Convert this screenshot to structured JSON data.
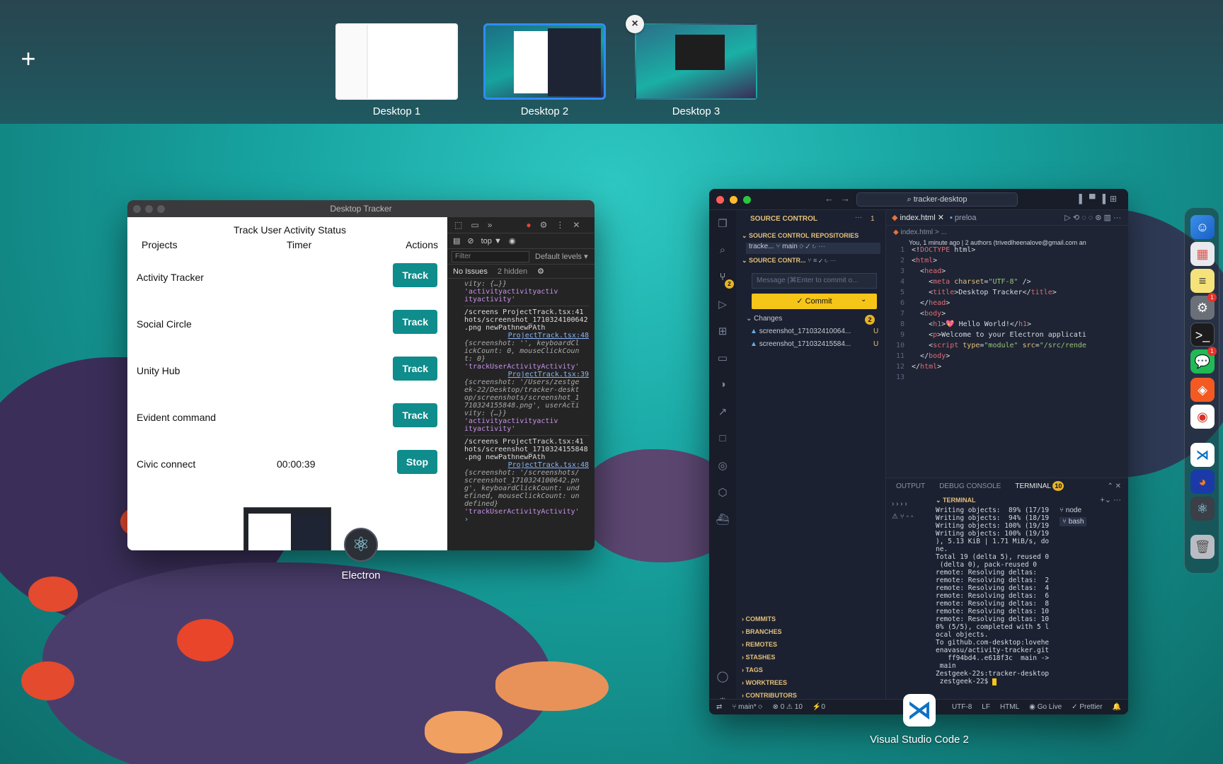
{
  "spaces": {
    "add_label": "+",
    "desktops": [
      {
        "label": "Desktop 1"
      },
      {
        "label": "Desktop 2"
      },
      {
        "label": "Desktop 3"
      }
    ],
    "close_label": "×"
  },
  "electron": {
    "window_title": "Desktop Tracker",
    "app_title": "Track User Activity Status",
    "columns": {
      "projects": "Projects",
      "timer": "Timer",
      "actions": "Actions"
    },
    "rows": [
      {
        "name": "Activity Tracker",
        "timer": "",
        "action": "Track"
      },
      {
        "name": "Social Circle",
        "timer": "",
        "action": "Track"
      },
      {
        "name": "Unity Hub",
        "timer": "",
        "action": "Track"
      },
      {
        "name": "Evident command",
        "timer": "",
        "action": "Track"
      },
      {
        "name": "Civic connect",
        "timer": "00:00:39",
        "action": "Stop"
      }
    ],
    "app_label": "Electron",
    "devtools": {
      "context": "top ▼",
      "filter_placeholder": "Filter",
      "levels": "Default levels ▾",
      "issues": "No Issues",
      "hidden": "2 hidden",
      "console": [
        {
          "t": "vity: {…}}",
          "c": "ital"
        },
        {
          "t": "'activityactivityactiv",
          "c": "purple"
        },
        {
          "t": "ityactivity'",
          "c": "purple"
        },
        {
          "t": "/screens ProjectTrack.tsx:41",
          "c": "sep"
        },
        {
          "t": "hots/screenshot_1710324100642",
          "c": ""
        },
        {
          "t": ".png newPathnewPAth",
          "c": ""
        },
        {
          "t": "ProjectTrack.tsx:48",
          "c": "link"
        },
        {
          "t": "{screenshot: '', keyboardCl",
          "c": "ital"
        },
        {
          "t": "ickCount: 0, mouseClickCoun",
          "c": "ital"
        },
        {
          "t": "t: 0}",
          "c": "ital"
        },
        {
          "t": "'trackUserActivityActivity'",
          "c": "purple"
        },
        {
          "t": "ProjectTrack.tsx:39",
          "c": "link"
        },
        {
          "t": "{screenshot: '/Users/zestge",
          "c": "ital"
        },
        {
          "t": "ek-22/Desktop/tracker-deskt",
          "c": "ital"
        },
        {
          "t": "op/screenshots/screenshot_1",
          "c": "ital"
        },
        {
          "t": "710324155848.png', userActi",
          "c": "ital"
        },
        {
          "t": "vity: {…}}",
          "c": "ital"
        },
        {
          "t": "'activityactivityactiv",
          "c": "purple"
        },
        {
          "t": "ityactivity'",
          "c": "purple"
        },
        {
          "t": "/screens ProjectTrack.tsx:41",
          "c": "sep"
        },
        {
          "t": "hots/screenshot_1710324155848",
          "c": ""
        },
        {
          "t": ".png newPathnewPAth",
          "c": ""
        },
        {
          "t": "ProjectTrack.tsx:48",
          "c": "link"
        },
        {
          "t": "{screenshot: '/screenshots/",
          "c": "ital"
        },
        {
          "t": "screenshot_1710324100642.pn",
          "c": "ital"
        },
        {
          "t": "g', keyboardClickCount: und",
          "c": "ital"
        },
        {
          "t": "efined, mouseClickCount: un",
          "c": "ital"
        },
        {
          "t": "defined}",
          "c": "ital"
        },
        {
          "t": "'trackUserActivityActivity'",
          "c": "purple"
        }
      ]
    }
  },
  "vscode": {
    "search": "tracker-desktop",
    "app_label": "Visual Studio Code 2",
    "sidebar": {
      "header": "SOURCE CONTROL",
      "header_count": "1",
      "repositories": "SOURCE CONTROL REPOSITORIES",
      "repo_name": "tracke...",
      "branch": "main",
      "source_control": "SOURCE CONTR...",
      "message_placeholder": "Message (⌘Enter to commit o...",
      "commit": "✓ Commit",
      "changes": "Changes",
      "changes_count": "2",
      "files": [
        {
          "name": "screenshot_171032410064...",
          "status": "U"
        },
        {
          "name": "screenshot_171032415584...",
          "status": "U"
        }
      ],
      "sections": [
        "COMMITS",
        "BRANCHES",
        "REMOTES",
        "STASHES",
        "TAGS",
        "WORKTREES",
        "CONTRIBUTORS"
      ]
    },
    "editor": {
      "tab1": "index.html",
      "tab2": "preloa",
      "crumb": "index.html > ...",
      "blame": "You, 1 minute ago | 2 authors (trivedlheenalove@gmail.com an",
      "lines": [
        {
          "n": "1",
          "html": "<span class='tx'>&lt;!</span><span class='tg'>DOCTYPE</span><span class='tx'> html&gt;</span>"
        },
        {
          "n": "2",
          "html": "<span class='tx'>&lt;</span><span class='tg'>html</span><span class='tx'>&gt;</span>"
        },
        {
          "n": "3",
          "html": "  <span class='tx'>&lt;</span><span class='tg'>head</span><span class='tx'>&gt;</span>"
        },
        {
          "n": "4",
          "html": "    <span class='tx'>&lt;</span><span class='tg'>meta</span> <span class='at'>charset</span><span class='tx'>=</span><span class='st'>\"UTF-8\"</span><span class='tx'> /&gt;</span>"
        },
        {
          "n": "5",
          "html": "    <span class='tx'>&lt;</span><span class='tg'>title</span><span class='tx'>&gt;Desktop Tracker&lt;/</span><span class='tg'>title</span><span class='tx'>&gt;</span>"
        },
        {
          "n": "6",
          "html": "  <span class='tx'>&lt;/</span><span class='tg'>head</span><span class='tx'>&gt;</span>"
        },
        {
          "n": "7",
          "html": "  <span class='tx'>&lt;</span><span class='tg'>body</span><span class='tx'>&gt;</span>"
        },
        {
          "n": "8",
          "html": "    <span class='tx'>&lt;</span><span class='tg'>h1</span><span class='tx'>&gt;💖 Hello World!&lt;/</span><span class='tg'>h1</span><span class='tx'>&gt;</span>"
        },
        {
          "n": "9",
          "html": "    <span class='tx'>&lt;</span><span class='tg'>p</span><span class='tx'>&gt;Welcome to your Electron applicati</span>"
        },
        {
          "n": "10",
          "html": "    <span class='tx'>&lt;</span><span class='tg'>script</span> <span class='at'>type</span><span class='tx'>=</span><span class='st'>\"module\"</span> <span class='at'>src</span><span class='tx'>=</span><span class='st'>\"/src/rende</span>"
        },
        {
          "n": "11",
          "html": "  <span class='tx'>&lt;/</span><span class='tg'>body</span><span class='tx'>&gt;</span>"
        },
        {
          "n": "12",
          "html": "<span class='tx'>&lt;/</span><span class='tg'>html</span><span class='tx'>&gt;</span>"
        },
        {
          "n": "13",
          "html": ""
        }
      ]
    },
    "panel": {
      "tabs": [
        "OUTPUT",
        "DEBUG CONSOLE",
        "TERMINAL"
      ],
      "terminal_badge": "10",
      "terminal_title": "TERMINAL",
      "sessions": [
        "node",
        "bash"
      ],
      "lines": [
        "Writing objects:  89% (17/19",
        "Writing objects:  94% (18/19",
        "Writing objects: 100% (19/19",
        "Writing objects: 100% (19/19",
        "), 5.13 KiB | 1.71 MiB/s, do",
        "ne.",
        "Total 19 (delta 5), reused 0",
        " (delta 0), pack-reused 0",
        "remote: Resolving deltas:",
        "remote: Resolving deltas:  2",
        "remote: Resolving deltas:  4",
        "remote: Resolving deltas:  6",
        "remote: Resolving deltas:  8",
        "remote: Resolving deltas: 10",
        "remote: Resolving deltas: 10",
        "0% (5/5), completed with 5 l",
        "ocal objects.",
        "To github.com-desktop:lovehe",
        "enavasu/activity-tracker.git",
        "   ff94bd4..e618f3c  main ->",
        " main",
        "Zestgeek-22s:tracker-desktop",
        " zestgeek-22$ "
      ]
    },
    "status": {
      "branch": "main*",
      "errors": "⊗ 0 ⚠ 10",
      "ports": "⚡0",
      "encoding": "UTF-8",
      "eol": "LF",
      "lang": "HTML",
      "live": "Go Live",
      "prettier": "✓ Prettier"
    }
  },
  "colors": {
    "accent_teal": "#0f8c8c",
    "commit_yellow": "#f5c518",
    "selection_blue": "#2f8cff"
  }
}
